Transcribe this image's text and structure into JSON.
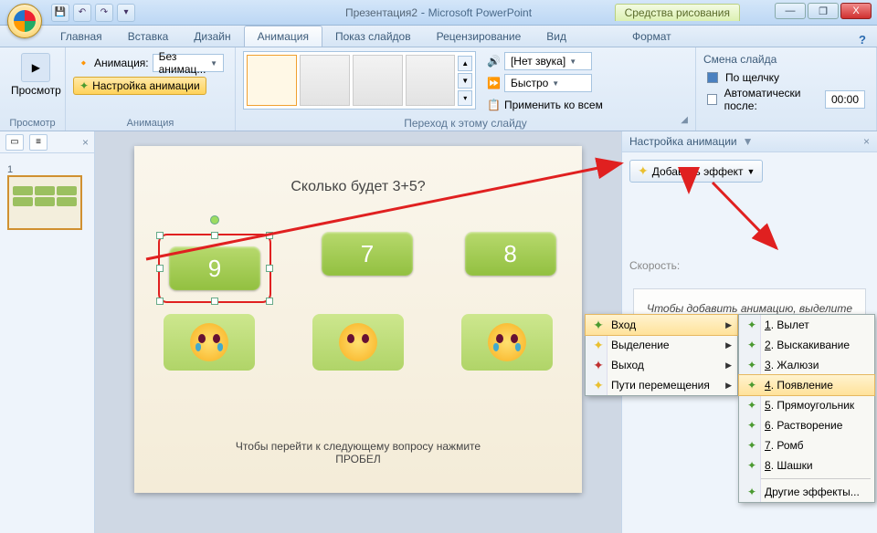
{
  "title": {
    "doc": "Презентация2",
    "app": "Microsoft PowerPoint"
  },
  "tooltab": "Средства рисования",
  "winbtns": {
    "min": "—",
    "max": "❐",
    "close": "X"
  },
  "qat": [
    "💾",
    "↶",
    "↷"
  ],
  "tabs": [
    "Главная",
    "Вставка",
    "Дизайн",
    "Анимация",
    "Показ слайдов",
    "Рецензирование",
    "Вид",
    "Формат"
  ],
  "active_tab": 3,
  "help": "?",
  "ribbon": {
    "preview": {
      "label": "Просмотр",
      "group": "Просмотр"
    },
    "anim": {
      "animation": "Анимация:",
      "animation_val": "Без анимац...",
      "customize": "Настройка анимации",
      "group": "Анимация"
    },
    "trans": {
      "sound_lbl": "[Нет звука]",
      "speed_lbl": "Быстро",
      "apply_all": "Применить ко всем",
      "group": "Переход к этому слайду"
    },
    "advance": {
      "title": "Смена слайда",
      "on_click": "По щелчку",
      "auto_after": "Автоматически после:",
      "time": "00:00"
    }
  },
  "nav": {
    "slide_num": "1"
  },
  "slide": {
    "title": "Сколько будет 3+5?",
    "answers": [
      "9",
      "7",
      "8"
    ],
    "hint1": "Чтобы перейти к следующему вопросу нажмите",
    "hint2": "ПРОБЕЛ"
  },
  "taskpane": {
    "title": "Настройка анимации",
    "add_effect": "Добавить эффект",
    "speed": "Скорость:",
    "hint": "Чтобы добавить анимацию, выделите элемент на слайде, а затем нажмите кнопку \"Добавить эффект\"."
  },
  "menu1": [
    {
      "icon": "green",
      "label": "Вход",
      "sub": true,
      "hl": true
    },
    {
      "icon": "yellow",
      "label": "Выделение",
      "sub": true
    },
    {
      "icon": "red",
      "label": "Выход",
      "sub": true
    },
    {
      "icon": "star",
      "label": "Пути перемещения",
      "sub": true
    }
  ],
  "menu2": [
    {
      "num": "1",
      "label": "Вылет"
    },
    {
      "num": "2",
      "label": "Выскакивание"
    },
    {
      "num": "3",
      "label": "Жалюзи"
    },
    {
      "num": "4",
      "label": "Появление",
      "hl": true
    },
    {
      "num": "5",
      "label": "Прямоугольник"
    },
    {
      "num": "6",
      "label": "Растворение"
    },
    {
      "num": "7",
      "label": "Ромб"
    },
    {
      "num": "8",
      "label": "Шашки"
    },
    {
      "sep": true
    },
    {
      "label": "Другие эффекты..."
    }
  ]
}
